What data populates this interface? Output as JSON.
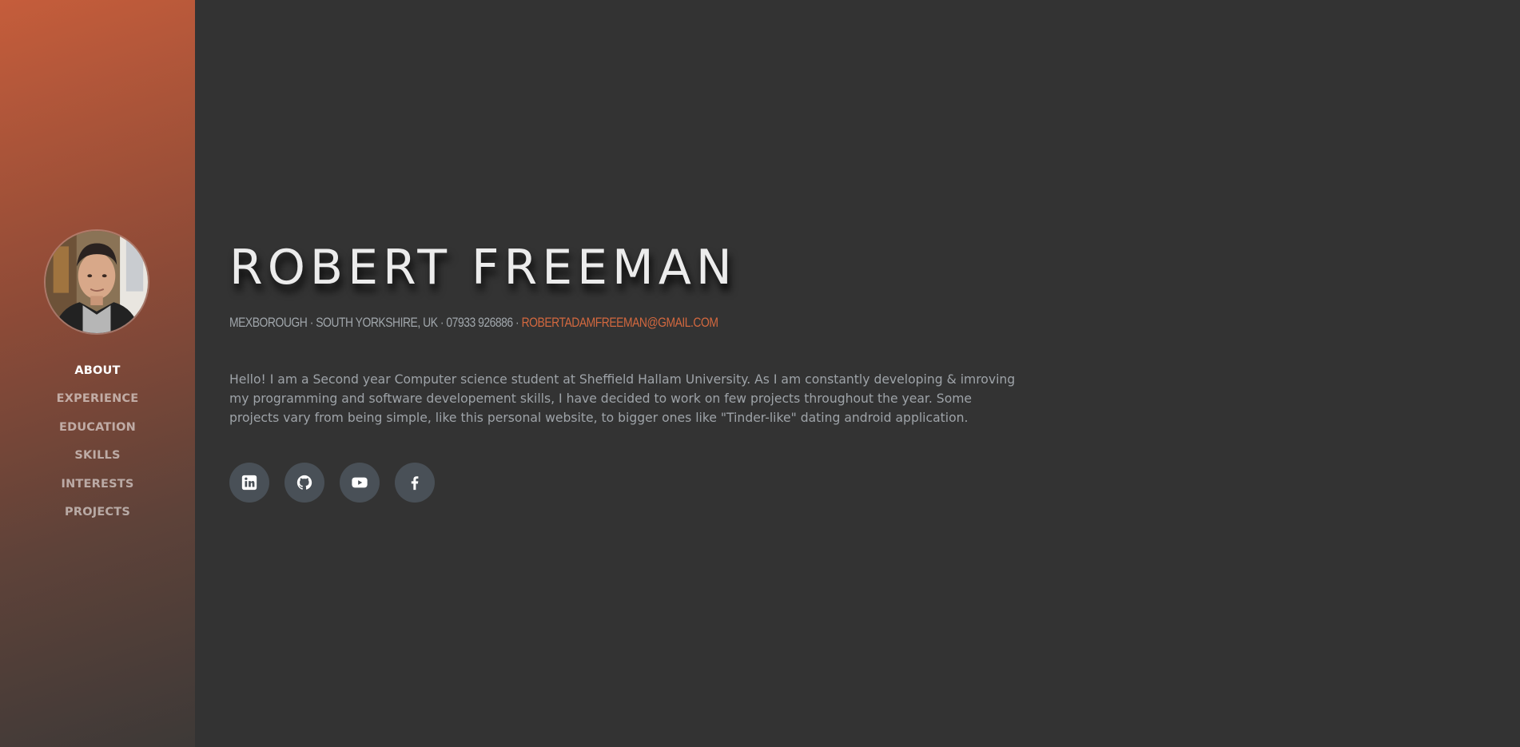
{
  "profile": {
    "name": "ROBERT FREEMAN",
    "address": "MEXBOROUGH · SOUTH YORKSHIRE, UK · 07933 926886 ·",
    "email": "ROBERTADAMFREEMAN@GMAIL.COM",
    "intro": "Hello! I am a Second year Computer science student at Sheffield Hallam University. As I am constantly developing & imroving my programming and software developement skills, I have decided to work on few projects throughout the year. Some projects vary from being simple, like this personal website, to bigger ones like \"Tinder-like\" dating android application."
  },
  "nav": {
    "items": [
      {
        "label": "About",
        "active": true
      },
      {
        "label": "Experience"
      },
      {
        "label": "Education"
      },
      {
        "label": "Skills"
      },
      {
        "label": "Interests"
      },
      {
        "label": "Projects"
      }
    ]
  },
  "social": {
    "links": [
      {
        "icon": "linkedin-icon"
      },
      {
        "icon": "github-icon"
      },
      {
        "icon": "youtube-icon"
      },
      {
        "icon": "facebook-icon"
      }
    ]
  },
  "colors": {
    "accent": "#bd5d38",
    "link": "#d2683f",
    "background": "#333333",
    "social_button": "#495057"
  }
}
